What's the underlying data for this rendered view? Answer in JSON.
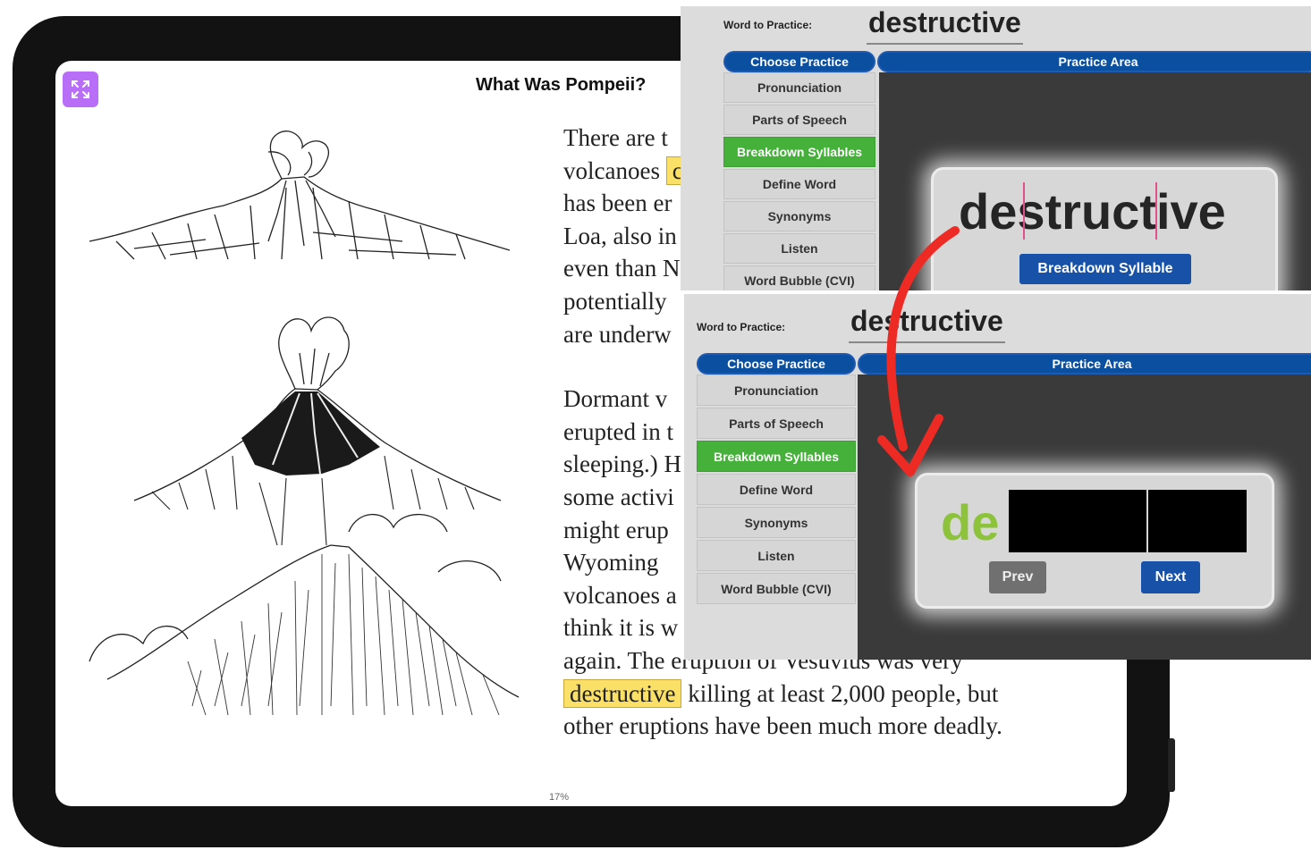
{
  "book": {
    "title": "What Was Pompeii?",
    "page_percent": "17%",
    "text_lines_p1": [
      "There are t",
      "volcanoes",
      "has been er",
      "Loa, also in",
      "even than N",
      "potentially",
      "are underw"
    ],
    "highlight_p1": "c",
    "text_lines_p2": [
      "Dormant v",
      "erupted in t",
      "sleeping.) H",
      "some activi",
      "might erup",
      "Wyoming",
      "volcanoes a",
      "think it is w",
      "again. The eruption of Vesuvius was very"
    ],
    "highlight_word": "destructive",
    "after_highlight": " killing at least 2,000 people, but",
    "final_line": "other eruptions have been much more deadly."
  },
  "panel_top": {
    "word_label": "Word to Practice:",
    "word": "destructive",
    "tab_choose": "Choose Practice",
    "tab_area": "Practice Area",
    "menu": [
      "Pronunciation",
      "Parts of Speech",
      "Breakdown Syllables",
      "Define Word",
      "Synonyms",
      "Listen",
      "Word Bubble (CVI)"
    ],
    "active_index": 2,
    "display_word": "destructive",
    "button_label": "Breakdown Syllable"
  },
  "panel_bottom": {
    "word_label": "Word to Practice:",
    "word": "destructive",
    "tab_choose": "Choose Practice",
    "tab_area": "Practice Area",
    "menu": [
      "Pronunciation",
      "Parts of Speech",
      "Breakdown Syllables",
      "Define Word",
      "Synonyms",
      "Listen",
      "Word Bubble (CVI)"
    ],
    "active_index": 2,
    "shown_syllable": "de",
    "prev_label": "Prev",
    "next_label": "Next"
  },
  "colors": {
    "active_menu": "#45b03a",
    "tab_blue": "#0b4fa0",
    "arrow": "#ee2a24",
    "highlight": "#fbe068",
    "syllable_green": "#8cc33a",
    "expand_button": "#b96ef7"
  }
}
